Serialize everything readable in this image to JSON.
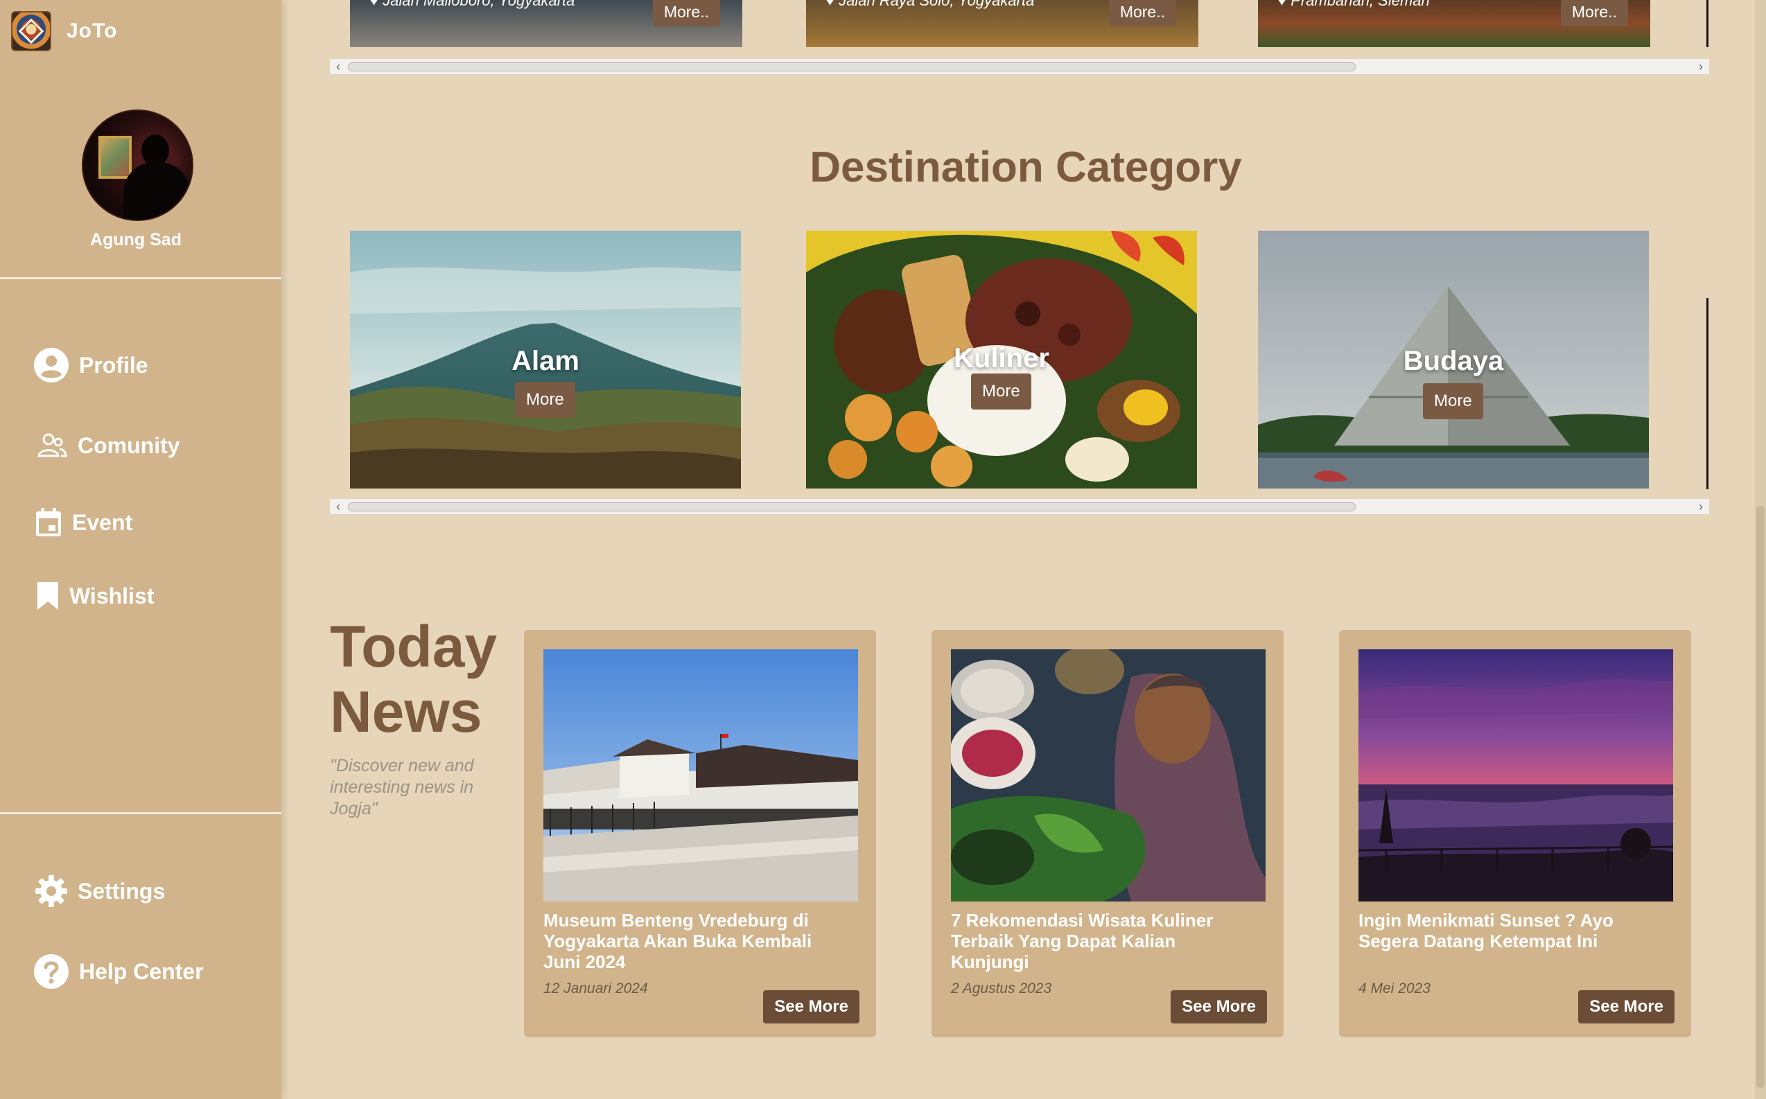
{
  "app": {
    "name": "JoTo"
  },
  "user": {
    "name": "Agung Sad"
  },
  "sidebar": {
    "items": [
      {
        "label": "Profile",
        "icon": "user-circle-icon"
      },
      {
        "label": "Comunity",
        "icon": "community-icon"
      },
      {
        "label": "Event",
        "icon": "calendar-icon"
      },
      {
        "label": "Wishlist",
        "icon": "bookmark-icon"
      }
    ],
    "bottom_items": [
      {
        "label": "Settings",
        "icon": "gear-icon"
      },
      {
        "label": "Help Center",
        "icon": "help-icon"
      }
    ]
  },
  "top_destinations": [
    {
      "location": "Jalan Malioboro, Yogyakarta",
      "button": "More.."
    },
    {
      "location": "Jalan Raya Solo, Yogyakarta",
      "button": "More.."
    },
    {
      "location": "Prambanan, Sleman",
      "button": "More.."
    }
  ],
  "categories": {
    "title": "Destination Category",
    "items": [
      {
        "label": "Alam",
        "button": "More"
      },
      {
        "label": "Kuliner",
        "button": "More"
      },
      {
        "label": "Budaya",
        "button": "More"
      }
    ]
  },
  "news": {
    "title_line1": "Today",
    "title_line2": "News",
    "quote": "\"Discover new and interesting news in Jogja\"",
    "items": [
      {
        "headline": "Museum Benteng Vredeburg di Yogyakarta Akan Buka Kembali Juni 2024",
        "date": "12 Januari 2024",
        "button": "See More"
      },
      {
        "headline": "7 Rekomendasi Wisata Kuliner Terbaik Yang Dapat Kalian Kunjungi",
        "date": "2 Agustus 2023",
        "button": "See More"
      },
      {
        "headline": "Ingin Menikmati Sunset ? Ayo Segera Datang Ketempat Ini",
        "date": "4 Mei 2023",
        "button": "See More"
      }
    ]
  },
  "colors": {
    "sidebar": "#d2b48c",
    "background": "#e6d5b8",
    "accent_text": "#7b5a3e",
    "button": "#6b4c36"
  }
}
